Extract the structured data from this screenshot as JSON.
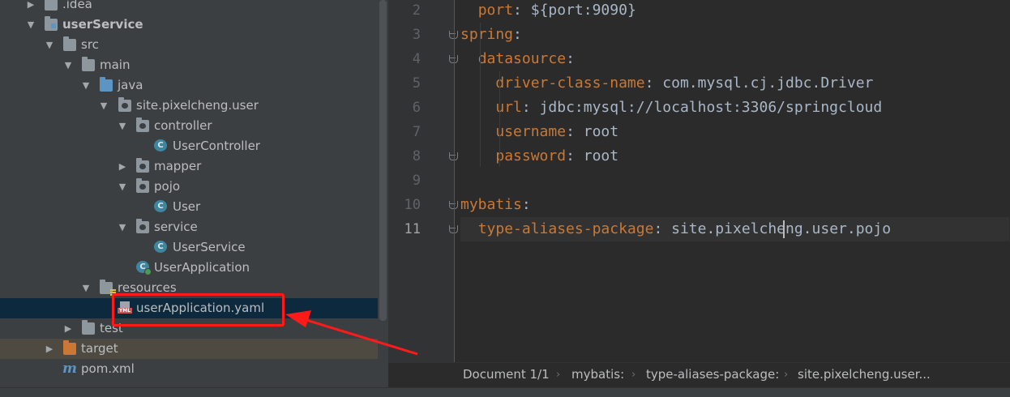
{
  "project_tree": {
    "items": [
      {
        "label": ".idea"
      },
      {
        "label": "userService"
      },
      {
        "label": "src"
      },
      {
        "label": "main"
      },
      {
        "label": "java"
      },
      {
        "label": "site.pixelcheng.user"
      },
      {
        "label": "controller"
      },
      {
        "label": "UserController",
        "badge": "C"
      },
      {
        "label": "mapper"
      },
      {
        "label": "pojo"
      },
      {
        "label": "User",
        "badge": "C"
      },
      {
        "label": "service"
      },
      {
        "label": "UserService",
        "badge": "C"
      },
      {
        "label": "UserApplication",
        "badge": "C"
      },
      {
        "label": "resources"
      },
      {
        "label": "userApplication.yaml",
        "badge": "YML"
      },
      {
        "label": "test"
      },
      {
        "label": "target"
      },
      {
        "label": "pom.xml",
        "badge": "m"
      }
    ]
  },
  "editor": {
    "lines": [
      {
        "number": "2",
        "indent": "  ",
        "key": "port",
        "sep": ": ",
        "value": "${port:9090}"
      },
      {
        "number": "3",
        "indent": "",
        "key": "spring",
        "sep": ":",
        "value": ""
      },
      {
        "number": "4",
        "indent": "  ",
        "key": "datasource",
        "sep": ":",
        "value": ""
      },
      {
        "number": "5",
        "indent": "    ",
        "key": "driver-class-name",
        "sep": ": ",
        "value": "com.mysql.cj.jdbc.Driver"
      },
      {
        "number": "6",
        "indent": "    ",
        "key": "url",
        "sep": ": ",
        "value": "jdbc:mysql://localhost:3306/springcloud"
      },
      {
        "number": "7",
        "indent": "    ",
        "key": "username",
        "sep": ": ",
        "value": "root"
      },
      {
        "number": "8",
        "indent": "    ",
        "key": "password",
        "sep": ": ",
        "value": "root"
      },
      {
        "number": "9",
        "indent": "",
        "key": "",
        "sep": "",
        "value": ""
      },
      {
        "number": "10",
        "indent": "",
        "key": "mybatis",
        "sep": ":",
        "value": ""
      },
      {
        "number": "11",
        "indent": "  ",
        "key": "type-aliases-package",
        "sep": ": ",
        "value": "site.pixelcheng.user.pojo"
      }
    ],
    "current_line": "11"
  },
  "breadcrumb": {
    "document": "Document 1/1",
    "items": [
      "mybatis:",
      "type-aliases-package:",
      "site.pixelcheng.user..."
    ]
  },
  "annotation": {
    "highlight_color": "#ff1a1a"
  },
  "colors": {
    "yaml_key": "#cc7832",
    "text": "#a9b7c6",
    "tree_bg": "#3c3f41",
    "editor_bg": "#2b2b2b",
    "selection": "#0d293e"
  }
}
